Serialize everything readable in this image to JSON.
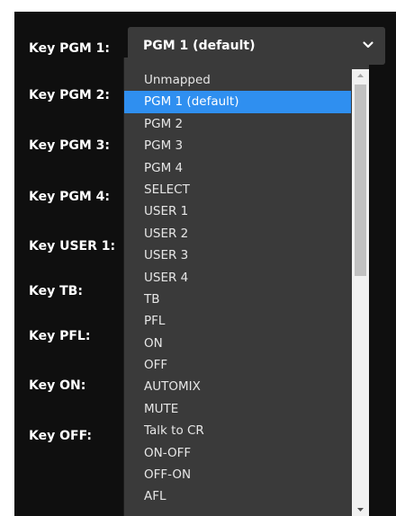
{
  "rows": [
    {
      "label": "Key PGM 1:"
    },
    {
      "label": "Key PGM 2:"
    },
    {
      "label": "Key PGM 3:"
    },
    {
      "label": "Key PGM 4:"
    },
    {
      "label": "Key USER 1:"
    },
    {
      "label": "Key TB:"
    },
    {
      "label": "Key PFL:"
    },
    {
      "label": "Key ON:"
    },
    {
      "label": "Key OFF:"
    }
  ],
  "select": {
    "value": "PGM 1 (default)",
    "icon": "chevron-down-icon"
  },
  "dropdown": {
    "selected_index": 1,
    "options": [
      "Unmapped",
      "PGM 1 (default)",
      "PGM 2",
      "PGM 3",
      "PGM 4",
      "SELECT",
      "USER 1",
      "USER 2",
      "USER 3",
      "USER 4",
      "TB",
      "PFL",
      "ON",
      "OFF",
      "AUTOMIX",
      "MUTE",
      "Talk to CR",
      "ON-OFF",
      "OFF-ON",
      "AFL"
    ]
  },
  "colors": {
    "panel_bg": "#0f0f0f",
    "control_bg": "#3a3a3a",
    "highlight": "#2f8ff0",
    "text": "#ffffff"
  }
}
